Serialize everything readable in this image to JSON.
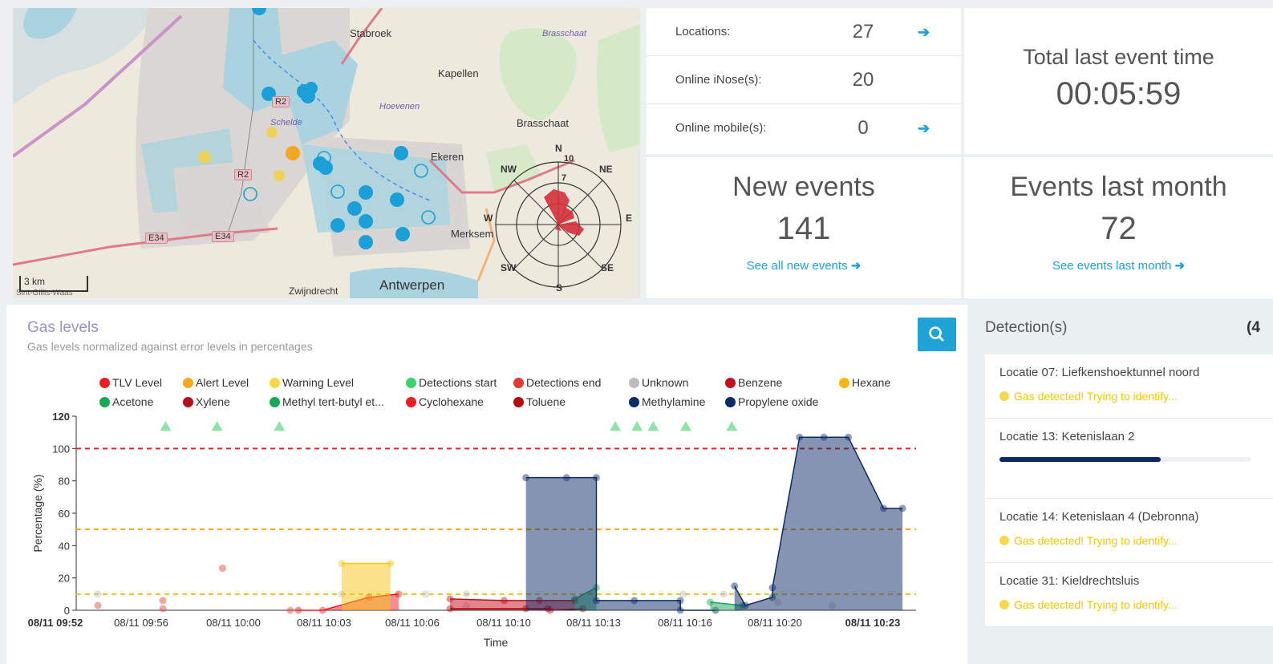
{
  "map": {
    "labels": {
      "stabroek": "Stabroek",
      "brasschaat_airport": "Brasschaat",
      "kapellen": "Kapellen",
      "hoevenen": "Hoevenen",
      "brasschaat": "Brasschaat",
      "schelde": "Schelde",
      "ekeren": "Ekeren",
      "merksem": "Merksem",
      "antwerpen": "Antwerpen",
      "zwijndrecht": "Zwijndrecht",
      "sint_gillis": "Sint-Gillis-Waas"
    },
    "roads": {
      "r2a": "R2",
      "r2b": "R2",
      "e34a": "E34",
      "e34b": "E34"
    },
    "scale": "3 km",
    "wind_rose": {
      "n": "N",
      "ne": "NE",
      "e": "E",
      "se": "SE",
      "s": "S",
      "sw": "SW",
      "w": "W",
      "nw": "NW",
      "r10": "10",
      "r7": "7"
    }
  },
  "stats": {
    "locations_label": "Locations:",
    "locations_value": "27",
    "inose_label": "Online iNose(s):",
    "inose_value": "20",
    "mobile_label": "Online mobile(s):",
    "mobile_value": "0"
  },
  "cards": {
    "total_time_title": "Total last event time",
    "total_time_value": "00:05:59",
    "new_events_title": "New events",
    "new_events_value": "141",
    "new_events_link": "See all new events",
    "last_month_title": "Events last month",
    "last_month_value": "72",
    "last_month_link": "See events last month"
  },
  "gas_chart": {
    "title": "Gas levels",
    "subtitle": "Gas levels normalized against error levels in percentages",
    "legend": [
      {
        "label": "TLV Level",
        "color": "#ee1d23"
      },
      {
        "label": "Alert Level",
        "color": "#f5a623"
      },
      {
        "label": "Warning Level",
        "color": "#f8d748"
      },
      {
        "label": "Detections start",
        "color": "#3cd070"
      },
      {
        "label": "Detections end",
        "color": "#e03c31"
      },
      {
        "label": "Unknown",
        "color": "#bdbdbd"
      },
      {
        "label": "Benzene",
        "color": "#c40d1e"
      },
      {
        "label": "Hexane",
        "color": "#f5b70f"
      },
      {
        "label": "Acetone",
        "color": "#18a957"
      },
      {
        "label": "Xylene",
        "color": "#b3121c"
      },
      {
        "label": "Methyl tert-butyl et...",
        "color": "#18a957"
      },
      {
        "label": "Cyclohexane",
        "color": "#ee1d23"
      },
      {
        "label": "Toluene",
        "color": "#b00d0d"
      },
      {
        "label": "Methylamine",
        "color": "#0b2a66"
      },
      {
        "label": "Propylene oxide",
        "color": "#0b2a66"
      }
    ]
  },
  "chart_data": {
    "type": "area",
    "title": "Gas levels",
    "xlabel": "Time",
    "ylabel": "Percentage (%)",
    "ylim": [
      0,
      120
    ],
    "yticks": [
      "0",
      "20",
      "40",
      "60",
      "80",
      "100",
      "120"
    ],
    "xticks": [
      "08/11 09:52",
      "08/11 09:56",
      "08/11 10:00",
      "08/11 10:03",
      "08/11 10:06",
      "08/11 10:10",
      "08/11 10:13",
      "08/11 10:16",
      "08/11 10:20",
      "08/11 10:23"
    ],
    "xlim_minutes": [
      0,
      31
    ],
    "reference_lines": [
      {
        "name": "TLV Level",
        "value": 100,
        "color": "#ee1d23"
      },
      {
        "name": "Alert Level",
        "value": 50,
        "color": "#f5a623"
      },
      {
        "name": "Warning Level",
        "value": 10,
        "color": "#e8c21c"
      }
    ],
    "detection_start_markers_minutes": [
      3.3,
      5.2,
      7.5,
      19.9,
      20.7,
      21.3,
      22.5,
      24.2
    ],
    "series": [
      {
        "name": "Unknown",
        "color": "#bdbdbd",
        "points": [
          [
            0.8,
            10
          ],
          [
            9.8,
            10
          ],
          [
            12.9,
            10
          ],
          [
            14.4,
            3
          ],
          [
            14.4,
            10
          ],
          [
            22.4,
            10
          ],
          [
            23.9,
            10
          ],
          [
            25.9,
            5
          ],
          [
            27.9,
            3
          ]
        ]
      },
      {
        "name": "Detections end",
        "color": "#e03c31",
        "points": [
          [
            0.8,
            3
          ],
          [
            3.2,
            6
          ],
          [
            3.2,
            1
          ],
          [
            5.4,
            26
          ],
          [
            7.9,
            0
          ]
        ]
      },
      {
        "name": "Cyclohexane",
        "color": "#ee1d23",
        "area": true,
        "points": [
          [
            8.2,
            0
          ],
          [
            9.1,
            0
          ],
          [
            10.8,
            8
          ],
          [
            11.9,
            10
          ]
        ]
      },
      {
        "name": "Warning Level",
        "color": "#f5c518",
        "area": true,
        "points": [
          [
            9.8,
            29
          ],
          [
            11.6,
            29
          ]
        ]
      },
      {
        "name": "Benzene",
        "color": "#c40d1e",
        "area": true,
        "points": [
          [
            13.8,
            7
          ],
          [
            15.8,
            6
          ],
          [
            17.1,
            6
          ],
          [
            18.4,
            6
          ]
        ]
      },
      {
        "name": "Toluene",
        "color": "#b00d0d",
        "area": true,
        "points": [
          [
            13.8,
            1
          ],
          [
            16.6,
            1
          ],
          [
            17.4,
            1
          ],
          [
            17.5,
            0
          ],
          [
            18.7,
            1
          ]
        ]
      },
      {
        "name": "Methyl tert-butyl et...",
        "color": "#18a957",
        "area": true,
        "points": [
          [
            18.4,
            7
          ],
          [
            19.2,
            14
          ]
        ]
      },
      {
        "name": "Methylamine",
        "color": "#0b2a66",
        "area": true,
        "points": [
          [
            16.6,
            82
          ],
          [
            18.1,
            82
          ],
          [
            19.2,
            82
          ],
          [
            19.2,
            6
          ],
          [
            20.6,
            6
          ],
          [
            22.3,
            6
          ],
          [
            22.3,
            0
          ],
          [
            23.6,
            0
          ]
        ]
      },
      {
        "name": "Acetone",
        "color": "#18a957",
        "area": true,
        "points": [
          [
            23.4,
            5
          ],
          [
            24.6,
            3
          ]
        ]
      },
      {
        "name": "Propylene oxide",
        "color": "#0b2a66",
        "area": true,
        "points": [
          [
            24.3,
            15
          ],
          [
            24.7,
            3
          ],
          [
            25.7,
            8
          ],
          [
            25.7,
            14
          ],
          [
            26.7,
            107
          ],
          [
            27.6,
            107
          ],
          [
            28.5,
            107
          ],
          [
            29.8,
            63
          ],
          [
            30.5,
            63
          ]
        ]
      }
    ]
  },
  "detections": {
    "title": "Detection(s)",
    "count": "(4",
    "items": [
      {
        "location": "Locatie 07: Liefkenshoektunnel noord",
        "status": "Gas detected! Trying to identify..."
      },
      {
        "location": "Locatie 13: Ketenislaan 2",
        "progress": 0.64
      },
      {
        "location": "Locatie 14: Ketenislaan 4 (Debronna)",
        "status": "Gas detected! Trying to identify..."
      },
      {
        "location": "Locatie 31: Kieldrechtsluis",
        "status": "Gas detected! Trying to identify..."
      }
    ]
  }
}
